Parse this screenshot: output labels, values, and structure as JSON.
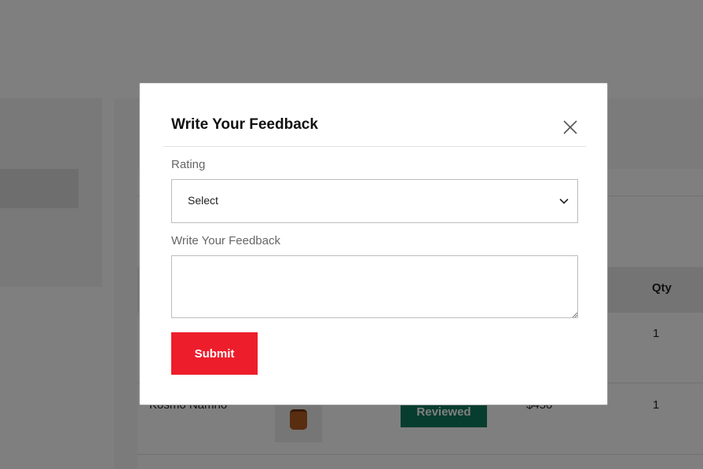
{
  "background": {
    "table": {
      "qty_header": "Qty",
      "rows": [
        {
          "qty": "1"
        },
        {
          "product": "Kosmo Namno",
          "status": "Reviewed",
          "price": "$450",
          "qty": "1"
        }
      ]
    },
    "colors": {
      "reviewed_badge": "#0f7a5c"
    }
  },
  "modal": {
    "title": "Write Your Feedback",
    "close_icon": "close-icon",
    "rating": {
      "label": "Rating",
      "selected": "Select",
      "chevron_icon": "chevron-down-icon"
    },
    "feedback": {
      "label": "Write Your Feedback",
      "value": ""
    },
    "submit_label": "Submit"
  },
  "colors": {
    "accent": "#ee1d2b",
    "overlay": "rgba(0,0,0,0.5)",
    "title_text": "#111111",
    "label_text": "#666666"
  }
}
